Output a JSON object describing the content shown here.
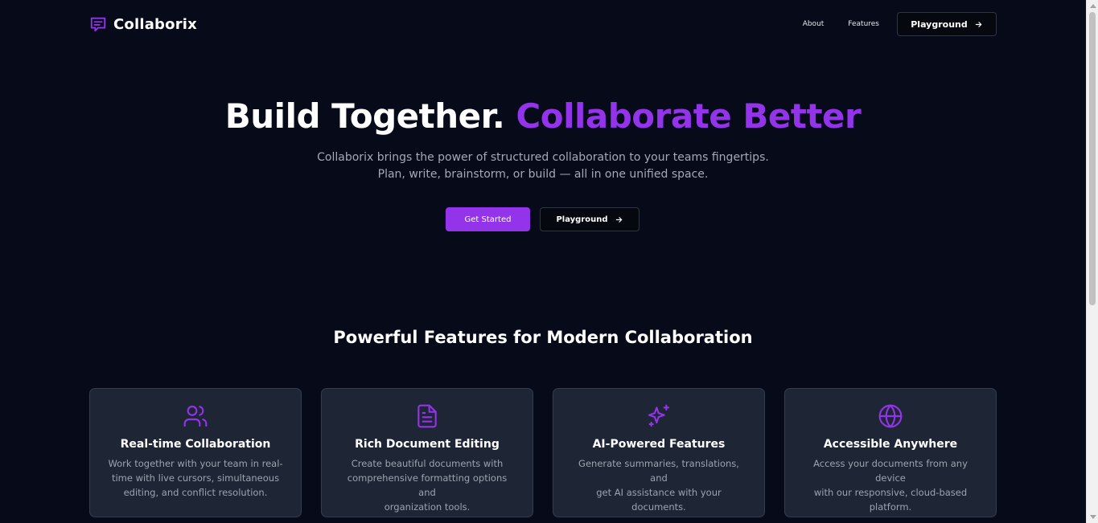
{
  "brand": {
    "name": "Collaborix",
    "icon": "message-square-text-icon"
  },
  "nav": {
    "about": "About",
    "features": "Features",
    "playground": "Playground"
  },
  "hero": {
    "title_main": "Build Together. ",
    "title_accent": "Collaborate Better",
    "subtitle_line1": "Collaborix brings the power of structured collaboration to your teams fingertips.",
    "subtitle_line2": "Plan, write, brainstorm, or build — all in one unified space.",
    "get_started": "Get Started",
    "playground": "Playground"
  },
  "features": {
    "title": "Powerful Features for Modern Collaboration",
    "cards": [
      {
        "icon": "users-icon",
        "title": "Real-time Collaboration",
        "line1": "Work together with your team in real-",
        "line2": "time with live cursors, simultaneous",
        "line3": "editing, and conflict resolution."
      },
      {
        "icon": "document-icon",
        "title": "Rich Document Editing",
        "line1": "Create beautiful documents with",
        "line2": "comprehensive formatting options and",
        "line3": "organization tools."
      },
      {
        "icon": "sparkles-icon",
        "title": "AI-Powered Features",
        "line1": "Generate summaries, translations, and",
        "line2": "get AI assistance with your documents.",
        "line3": ""
      },
      {
        "icon": "globe-icon",
        "title": "Accessible Anywhere",
        "line1": "Access your documents from any device",
        "line2": "with our responsive, cloud-based",
        "line3": "platform."
      }
    ]
  },
  "colors": {
    "background": "#070b19",
    "accent": "#9333ea",
    "card_bg": "#1e2635",
    "muted_text": "#9ca3af"
  }
}
